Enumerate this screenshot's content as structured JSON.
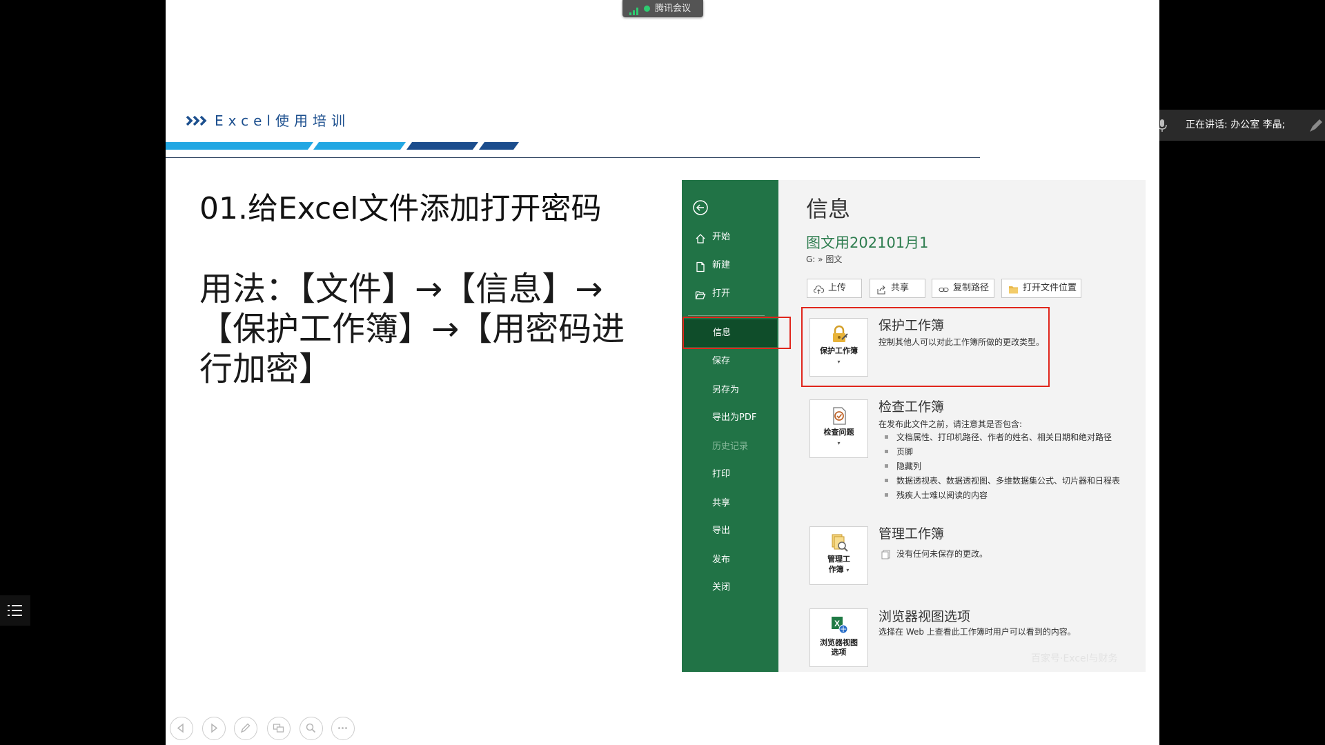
{
  "colors": {
    "excel_green": "#217346",
    "excel_green_active": "#0f4d2a",
    "highlight_red": "#e0251b",
    "header_blue": "#1c4f8e",
    "stripe_light": "#22a7e3",
    "stripe_dark": "#1b4d8d",
    "meeting_green": "#2ecc71"
  },
  "meeting": {
    "badge_label": "腾讯会议",
    "badge_icons": [
      "signal-bars-icon",
      "connection-dot-icon"
    ],
    "speaker_label": "正在讲话: 办公室 李晶;",
    "speaker_icons": [
      "microphone-icon",
      "pen-icon"
    ],
    "side_icon": "list-menu-icon",
    "toolbar_icons": [
      "previous-icon",
      "next-icon",
      "pen-icon",
      "screens-icon",
      "zoom-icon",
      "more-icon"
    ]
  },
  "slide": {
    "header_icon": "chevrons-icon",
    "header_title": "Excel使用培训",
    "title": "01.给Excel文件添加打开密码",
    "usage_lines": [
      "用法：【文件】→【信息】→",
      "【保护工作簿】→【用密码进",
      "行加密】"
    ]
  },
  "excel": {
    "back_icon": "back-arrow-icon",
    "sidebar": [
      {
        "label": "开始",
        "icon": "home-icon"
      },
      {
        "label": "新建",
        "icon": "new-document-icon"
      },
      {
        "label": "打开",
        "icon": "open-folder-icon"
      },
      {
        "label": "信息",
        "active": true
      },
      {
        "label": "保存"
      },
      {
        "label": "另存为"
      },
      {
        "label": "导出为PDF"
      },
      {
        "label": "历史记录",
        "disabled": true
      },
      {
        "label": "打印"
      },
      {
        "label": "共享"
      },
      {
        "label": "导出"
      },
      {
        "label": "发布"
      },
      {
        "label": "关闭"
      }
    ],
    "info": {
      "heading": "信息",
      "file_name": "图文用202101月1",
      "path": "G: » 图文",
      "actions": [
        {
          "label": "上传",
          "icon": "cloud-upload-icon"
        },
        {
          "label": "共享",
          "icon": "share-icon"
        },
        {
          "label": "复制路径",
          "icon": "link-icon"
        },
        {
          "label": "打开文件位置",
          "icon": "folder-icon"
        }
      ],
      "protect": {
        "button_label": "保护工作簿",
        "icon": "lock-key-icon",
        "title": "保护工作簿",
        "desc": "控制其他人可以对此工作簿所做的更改类型。"
      },
      "inspect": {
        "button_label": "检查问题",
        "icon": "inspect-document-icon",
        "title": "检查工作簿",
        "desc": "在发布此文件之前，请注意其是否包含:",
        "bullets": [
          "文档属性、打印机路径、作者的姓名、相关日期和绝对路径",
          "页脚",
          "隐藏列",
          "数据透视表、数据透视图、多维数据集公式、切片器和日程表",
          "残疾人士难以阅读的内容"
        ]
      },
      "manage": {
        "button_lines": [
          "管理工",
          "作簿"
        ],
        "icon": "manage-workbook-icon",
        "title": "管理工作簿",
        "desc": "没有任何未保存的更改。"
      },
      "browser": {
        "button_lines": [
          "浏览器视图",
          "选项"
        ],
        "icon": "browser-view-icon",
        "title": "浏览器视图选项",
        "desc": "选择在 Web 上查看此工作簿时用户可以看到的内容。"
      }
    },
    "watermark": "百家号·Excel与财务"
  }
}
